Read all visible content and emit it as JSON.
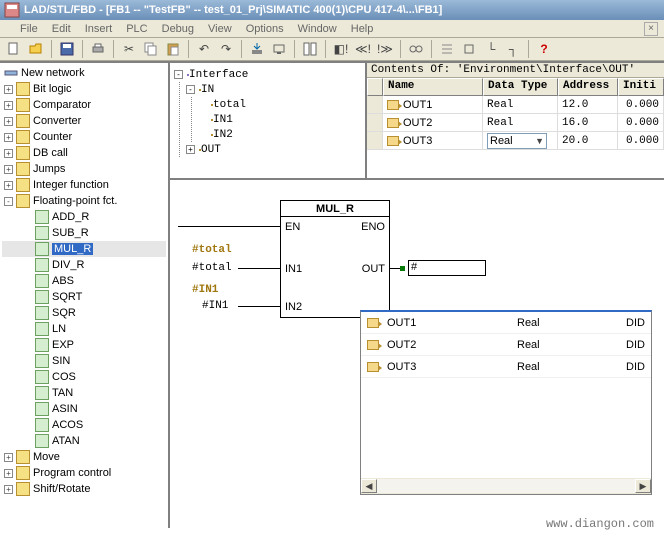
{
  "title": "LAD/STL/FBD  - [FB1 -- \"TestFB\" -- test_01_Prj\\SIMATIC 400(1)\\CPU 417-4\\...\\FB1]",
  "menu": {
    "file": "File",
    "edit": "Edit",
    "insert": "Insert",
    "plc": "PLC",
    "debug": "Debug",
    "view": "View",
    "options": "Options",
    "window": "Window",
    "help": "Help"
  },
  "tree": {
    "root": "New network",
    "items": [
      "Bit logic",
      "Comparator",
      "Converter",
      "Counter",
      "DB call",
      "Jumps",
      "Integer function",
      "Floating-point fct."
    ],
    "fp_children": [
      "ADD_R",
      "SUB_R",
      "MUL_R",
      "DIV_R",
      "ABS",
      "SQRT",
      "SQR",
      "LN",
      "EXP",
      "SIN",
      "COS",
      "TAN",
      "ASIN",
      "ACOS",
      "ATAN"
    ],
    "tail": [
      "Move",
      "Program control",
      "Shift/Rotate"
    ]
  },
  "interface": {
    "root": "Interface",
    "in": "IN",
    "in_children": [
      "total",
      "IN1",
      "IN2"
    ],
    "out": "OUT"
  },
  "grid": {
    "title": "Contents Of: 'Environment\\Interface\\OUT'",
    "headers": {
      "name": "Name",
      "type": "Data Type",
      "addr": "Address",
      "init": "Initi"
    },
    "rows": [
      {
        "name": "OUT1",
        "type": "Real",
        "addr": "12.0",
        "init": "0.000"
      },
      {
        "name": "OUT2",
        "type": "Real",
        "addr": "16.0",
        "init": "0.000"
      },
      {
        "name": "OUT3",
        "type": "Real",
        "addr": "20.0",
        "init": "0.000"
      }
    ]
  },
  "block": {
    "name": "MUL_R",
    "en": "EN",
    "eno": "ENO",
    "in1": "IN1",
    "out": "OUT",
    "in2": "IN2",
    "param_total_lbl": "#total",
    "param_total_var": "#total",
    "param_in1_lbl": "#IN1",
    "param_in1_var": "#IN1",
    "out_value": "#"
  },
  "hint": {
    "rows": [
      {
        "name": "OUT1",
        "type": "Real",
        "scope": "DID"
      },
      {
        "name": "OUT2",
        "type": "Real",
        "scope": "DID"
      },
      {
        "name": "OUT3",
        "type": "Real",
        "scope": "DID"
      }
    ]
  },
  "watermark": "www.diangon.com"
}
